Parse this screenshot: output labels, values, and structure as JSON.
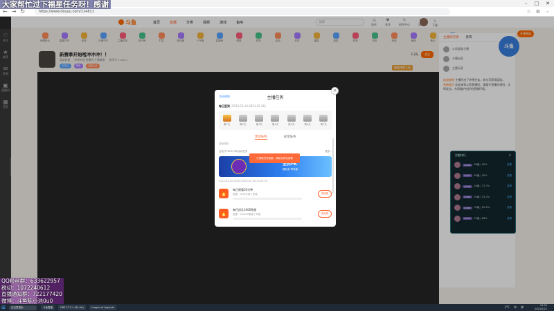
{
  "browser": {
    "url": "https://www.douyu.com/114811",
    "window_controls": [
      "–",
      "□",
      "✕"
    ]
  },
  "overlay_text": {
    "marquee": "大家帮忙过下福星任务呀！感谢",
    "promo": [
      "QQ粉丝群：633622957",
      "税切：1072240612",
      "直播通知群：722177420",
      "微博：斗鱼陈小浩0u0"
    ]
  },
  "left_rail": {
    "items": [
      "关注",
      "推荐",
      "鱼吧",
      "直播间",
      "签到"
    ]
  },
  "header": {
    "logo": "斗鱼",
    "nav": [
      "首页",
      "直播",
      "分类",
      "视频",
      "游戏",
      "鱼吧"
    ],
    "active_nav": "直播",
    "search_placeholder": "搜索",
    "icons": [
      {
        "label": "历史",
        "icon": "history-icon"
      },
      {
        "label": "关注",
        "icon": "follow-icon"
      },
      {
        "label": "创作中心",
        "icon": "create-icon"
      },
      {
        "label": "消息",
        "icon": "message-icon"
      },
      {
        "label": "下载",
        "icon": "download-icon"
      }
    ]
  },
  "gift_bar": {
    "items": [
      "荣耀粉丝",
      "星耀守护",
      "贵族",
      "开通守护",
      "主播任务",
      "排行榜",
      "打赏",
      "粉丝团",
      "人气值",
      "直播间",
      "弹幕",
      "礼物",
      "活动",
      "任务",
      "福袋",
      "抽奖",
      "签到",
      "背包",
      "商城",
      "鱼翅",
      "鱼丸",
      "充值"
    ],
    "cta": "开通贵族"
  },
  "streamer": {
    "title": "新赛季开始啦冲冲冲！！",
    "meta": [
      "英雄联盟",
      "哔哩哔哩·直播间·主播徽章",
      "房间号 114811"
    ],
    "tags": [
      "已关注",
      "超管",
      "主播认证"
    ],
    "follow_label": "关注",
    "follow_count": "1.2万",
    "rank_badge": "超级冲榜 1名"
  },
  "sidebar": {
    "tabs": [
      "主播排行榜",
      "贵宾"
    ],
    "active_tab": "主播排行榜",
    "ranking": [
      "斗鱼超级主播",
      "主播玩家",
      "主播玩家"
    ],
    "chat": [
      {
        "sys": "欢迎来到",
        "text": "主播开启了冲榜任务，参与可获得奖励。"
      },
      {
        "sys": "系统提示",
        "text": "欢迎来到斗鱼直播间，请遵守直播间规则，文明发言，共同维护良好的直播环境。"
      }
    ]
  },
  "mascot_label": "斗鱼",
  "leaderboard": {
    "title": "贡献排行",
    "rows": [
      {
        "badge": "10048",
        "stat": "64级 | 50%",
        "cta": "查看"
      },
      {
        "badge": "10072",
        "stat": "64级 | 50%",
        "cta": "查看"
      },
      {
        "badge": "10048",
        "stat": "44级 | 72.7%",
        "cta": "查看"
      },
      {
        "badge": "10065",
        "stat": "34级 | 25.2%",
        "cta": "查看"
      },
      {
        "badge": "10082",
        "stat": "32级 | 50.4%",
        "cta": "查看"
      },
      {
        "badge": "10072",
        "stat": "23级 | 86%",
        "cta": "查看"
      }
    ]
  },
  "modal": {
    "rule_link": "活动规则",
    "title": "主播任务",
    "daily_label": "每日签到",
    "daily_dates": "(2023.02.20-2023.02.26)",
    "checkin_days": [
      "第1天",
      "第2天",
      "第3天",
      "第4天",
      "第5天",
      "第6天",
      "第7天"
    ],
    "tabs": [
      "活动任务",
      "日常任务"
    ],
    "active_tab": "活动任务",
    "sub_label": "活动任务",
    "section_title": "全民打PK2023年活动任务",
    "section_more": "更多 ›",
    "banner_text": "全民PK",
    "banner_sub": "福利多·享特惠",
    "toast": "已领取任务奖励，请前往背包查看",
    "date_line": "2023-02-20 00:00-2023-02-26 23:59:59",
    "tasks": [
      {
        "name": "每日观看30分钟",
        "progress": "进度：0/30分钟 | 完成",
        "progress_fraction": 0,
        "button": "未完成"
      },
      {
        "name": "每日送礼1000鱼翅",
        "progress": "进度：0/1000鱼翅 | 完成",
        "progress_fraction": 0,
        "button": "未完成"
      }
    ]
  },
  "taskbar": {
    "search_placeholder": "在这里搜索",
    "apps": [
      "斗鱼直播",
      "OBS 27.2.4 (64-bit)",
      "League of Legends"
    ],
    "tray": [
      "2°C",
      "中",
      "拼"
    ],
    "time": "19:34",
    "date": "2023/2/21"
  }
}
